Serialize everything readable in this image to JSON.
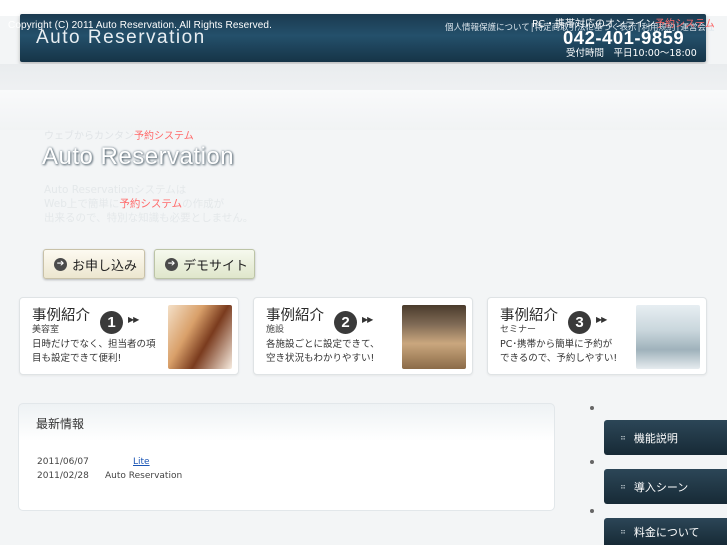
{
  "header": {
    "copyright": "Copyright (C) 2011 Auto Reservation. All Rights Reserved.",
    "logo": "Auto Reservation",
    "links": [
      "個人情報保護について",
      "特定商取引法に基づく表示",
      "利用規約",
      "運営会社"
    ],
    "pc_note_prefix": "PC・携帯対応のオンライン",
    "pc_note_highlight": "予約システム",
    "phone": "042-401-9859",
    "hours": "受付時間　平日10:00〜18:00"
  },
  "hero": {
    "sub_prefix": "ウェブからカンタン",
    "sub_highlight": "予約システム",
    "title": "Auto Reservation",
    "desc_line1": "Auto Reservationシステムは",
    "desc_line2_prefix": "Web上で簡単に",
    "desc_line2_highlight": "予約システム",
    "desc_line2_suffix": "の作成が",
    "desc_line3": "出来るので、特別な知識も必要としません。",
    "apply_label": "お申し込み",
    "demo_label": "デモサイト"
  },
  "cases": [
    {
      "heading": "事例紹介",
      "sub": "美容室",
      "num": "1",
      "line1": "日時だけでなく、担当者の項",
      "line2": "目も設定できて便利!"
    },
    {
      "heading": "事例紹介",
      "sub": "施設",
      "num": "2",
      "line1": "各施設ごとに設定できて、",
      "line2": "空き状況もわかりやすい!"
    },
    {
      "heading": "事例紹介",
      "sub": "セミナー",
      "num": "3",
      "line1": "PC･携帯から簡単に予約が",
      "line2": "できるので、予約しやすい!"
    }
  ],
  "news": {
    "title": "最新情報",
    "items": [
      {
        "date": "2011/06/07",
        "text": "Lite"
      },
      {
        "date": "2011/02/28",
        "text": "Auto Reservation"
      }
    ]
  },
  "side_nav": [
    {
      "label": "機能説明"
    },
    {
      "label": "導入シーン"
    },
    {
      "label": "料金について"
    }
  ],
  "colors": {
    "header_bar": "#1b3a50",
    "highlight": "#ff6a6a",
    "link": "#1a55b5",
    "side_nav": "#1f3646"
  }
}
